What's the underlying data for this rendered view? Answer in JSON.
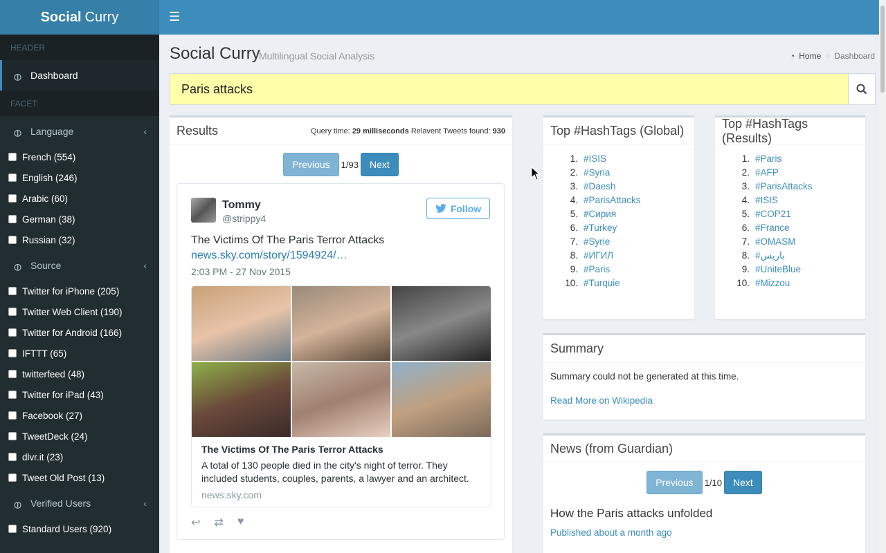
{
  "brand": {
    "bold": "Social",
    "light": "Curry"
  },
  "sidebar": {
    "header_label": "HEADER",
    "dashboard_label": "Dashboard",
    "facet_label": "FACET",
    "language": {
      "label": "Language",
      "items": [
        "French (554)",
        "English (246)",
        "Arabic (60)",
        "German (38)",
        "Russian (32)"
      ]
    },
    "source": {
      "label": "Source",
      "items": [
        "Twitter for iPhone (205)",
        "Twitter Web Client (190)",
        "Twitter for Android (166)",
        "IFTTT (65)",
        "twitterfeed (48)",
        "Twitter for iPad (43)",
        "Facebook (27)",
        "TweetDeck (24)",
        "dlvr.it (23)",
        "Tweet Old Post (13)"
      ]
    },
    "verified": {
      "label": "Verified Users",
      "items": [
        "Standard Users (920)"
      ]
    }
  },
  "page": {
    "title": "Social Curry",
    "subtitle": "Multilingual Social Analysis"
  },
  "breadcrumb": {
    "home": "Home",
    "current": "Dashboard"
  },
  "search": {
    "value": "Paris attacks"
  },
  "results": {
    "title": "Results",
    "query_time_label": "Query time:",
    "query_time_value": "29 milliseconds",
    "found_label": "Relavent Tweets found:",
    "found_value": "930",
    "prev": "Previous",
    "page": "1/93",
    "next": "Next"
  },
  "tweet": {
    "name": "Tommy",
    "handle": "@strippy4",
    "follow": "Follow",
    "text": "The Victims Of The Paris Terror Attacks",
    "link": "news.sky.com/story/1594924/…",
    "time": "2:03 PM - 27 Nov 2015",
    "card_title": "The Victims Of The Paris Terror Attacks",
    "card_desc": "A total of 130 people died in the city's night of terror. They included students, couples, parents, a lawyer and an architect.",
    "card_domain": "news.sky.com"
  },
  "global_tags": {
    "title": "Top #HashTags (Global)",
    "items": [
      "#ISIS",
      "#Syria",
      "#Daesh",
      "#ParisAttacks",
      "#Сирия",
      "#Turkey",
      "#Syrie",
      "#ИГИЛ",
      "#Paris",
      "#Turquie"
    ]
  },
  "result_tags": {
    "title": "Top #HashTags (Results)",
    "items": [
      "#Paris",
      "#AFP",
      "#ParisAttacks",
      "#ISIS",
      "#COP21",
      "#France",
      "#OMASM",
      "#باريس",
      "#UniteBlue",
      "#Mizzou"
    ]
  },
  "summary": {
    "title": "Summary",
    "text": "Summary could not be generated at this time.",
    "link": "Read More on Wikipedia"
  },
  "news": {
    "title": "News (from Guardian)",
    "prev": "Previous",
    "page": "1/10",
    "next": "Next",
    "headline": "How the Paris attacks unfolded",
    "date": "Published about a month ago"
  },
  "colors": {
    "sidebar": "#222d32",
    "topbar": "#3c8dbc",
    "search_bg": "#ffffa9",
    "link": "#3c8dbc"
  }
}
